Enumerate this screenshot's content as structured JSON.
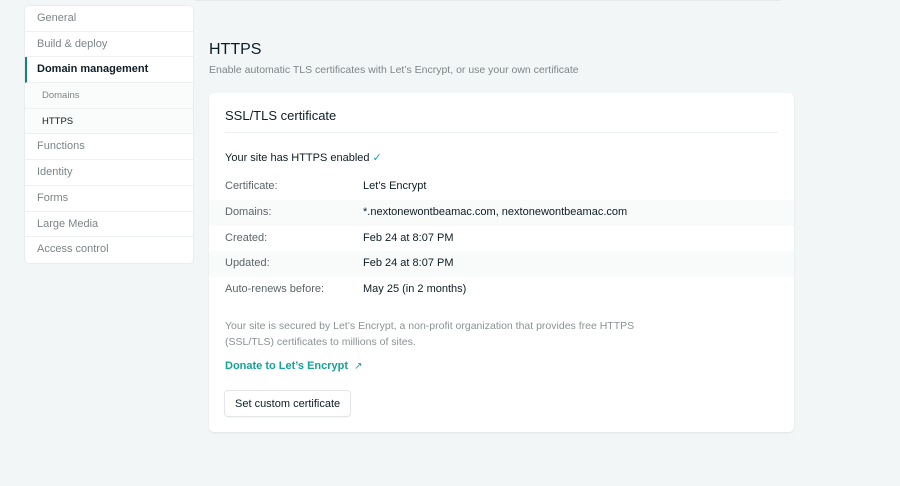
{
  "sidebar": {
    "items": [
      {
        "label": "General"
      },
      {
        "label": "Build & deploy"
      },
      {
        "label": "Domain management"
      },
      {
        "label": "Domains"
      },
      {
        "label": "HTTPS"
      },
      {
        "label": "Functions"
      },
      {
        "label": "Identity"
      },
      {
        "label": "Forms"
      },
      {
        "label": "Large Media"
      },
      {
        "label": "Access control"
      }
    ]
  },
  "header": {
    "title": "HTTPS",
    "subtitle": "Enable automatic TLS certificates with Let’s Encrypt, or use your own certificate"
  },
  "card": {
    "title": "SSL/TLS certificate",
    "status": "Your site has HTTPS enabled",
    "status_icon": "✓",
    "rows": [
      {
        "key": "Certificate:",
        "value": "Let’s Encrypt"
      },
      {
        "key": "Domains:",
        "value": "*.nextonewontbeamac.com, nextonewontbeamac.com"
      },
      {
        "key": "Created:",
        "value": "Feb 24 at 8:07 PM"
      },
      {
        "key": "Updated:",
        "value": "Feb 24 at 8:07 PM"
      },
      {
        "key": "Auto-renews before:",
        "value": "May 25 (in 2 months)"
      }
    ],
    "description": "Your site is secured by Let’s Encrypt, a non-profit organization that provides free HTTPS (SSL/TLS) certificates to millions of sites.",
    "donate_link": "Donate to Let’s Encrypt",
    "donate_icon": "↗",
    "custom_button": "Set custom certificate"
  }
}
